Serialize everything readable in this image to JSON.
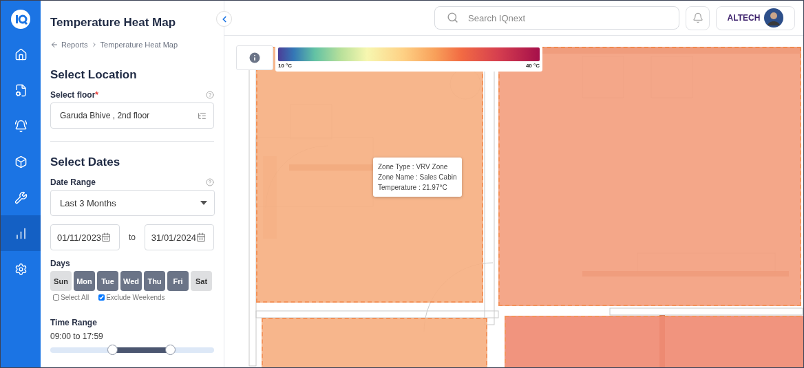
{
  "nav_items": [
    {
      "selected": false
    },
    {
      "selected": false
    },
    {
      "selected": false
    },
    {
      "selected": false
    },
    {
      "selected": false
    },
    {
      "selected": true
    },
    {
      "selected": false
    }
  ],
  "panel": {
    "title": "Temperature Heat Map",
    "breadcrumb": [
      "Reports",
      "Temperature Heat Map"
    ],
    "location_heading": "Select Location",
    "floor_label": "Select floor",
    "required_mark": "*",
    "floor_value": "Garuda Bhive , 2nd floor",
    "dates_heading": "Select Dates",
    "date_range_label": "Date Range",
    "date_range_value": "Last 3 Months",
    "from_date": "01/11/2023",
    "to_word": "to",
    "to_date": "31/01/2024",
    "days_label": "Days",
    "days": [
      {
        "label": "Sun",
        "selected": false
      },
      {
        "label": "Mon",
        "selected": true
      },
      {
        "label": "Tue",
        "selected": true
      },
      {
        "label": "Wed",
        "selected": true
      },
      {
        "label": "Thu",
        "selected": true
      },
      {
        "label": "Fri",
        "selected": true
      },
      {
        "label": "Sat",
        "selected": false
      }
    ],
    "options": [
      {
        "label": "Select All",
        "checked": false
      },
      {
        "label": "Exclude Weekends",
        "checked": true
      }
    ],
    "time_range_label": "Time Range",
    "time_range_value": "09:00 to 17:59",
    "slider": {
      "thumbs": [
        {
          "level": 0.378
        },
        {
          "level": 0.731
        }
      ]
    }
  },
  "header": {
    "search_placeholder": "Search IQnext",
    "user": "ALTECH"
  },
  "legend": {
    "min": "10 °C",
    "max": "40 °C"
  },
  "zones": [
    {
      "color": "#f7b083"
    },
    {
      "color": "#f4a07f"
    },
    {
      "color": "#f7b083"
    },
    {
      "color": "#f08b73"
    }
  ],
  "tooltip": [
    "Zone Type : VRV Zone",
    "Zone Name : Sales Cabin",
    "Temperature : 21.97°C"
  ]
}
